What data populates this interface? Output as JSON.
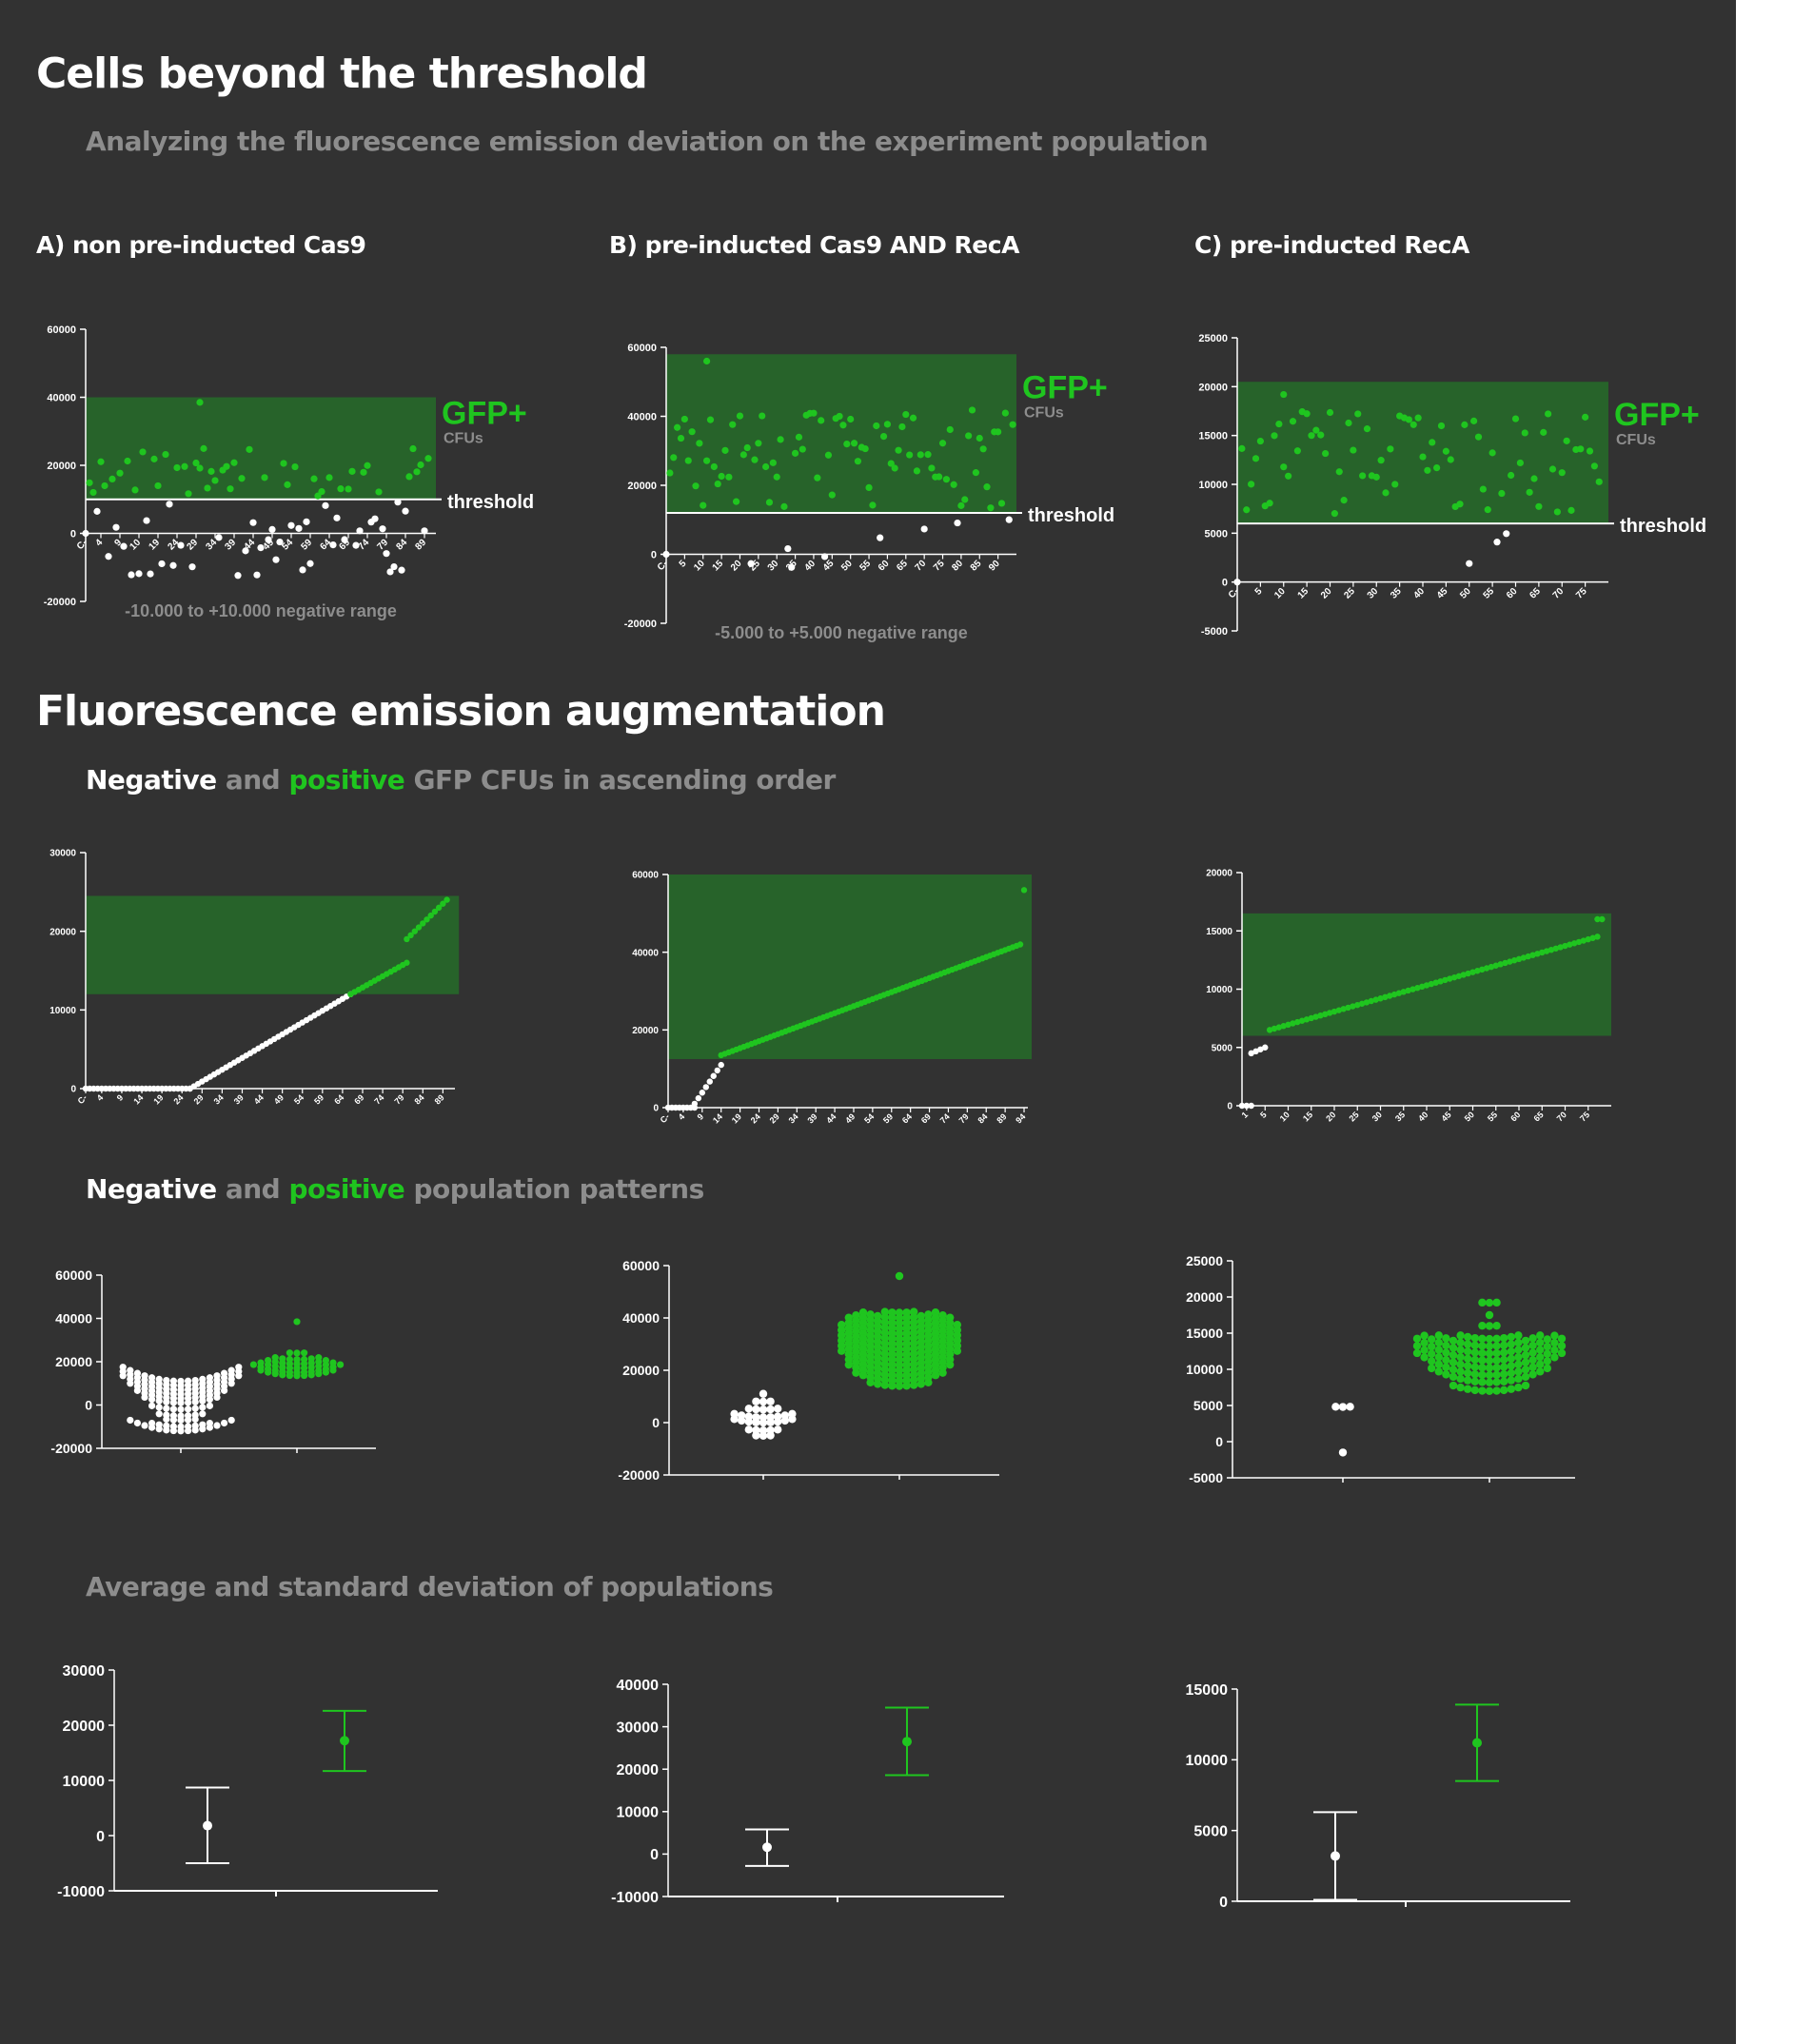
{
  "page": {
    "title": "Cells beyond the threshold",
    "subtitle": "Analyzing the fluorescence emission deviation on the experiment population",
    "section2_title": "Fluorescence emission augmentation",
    "asc": {
      "neg": "Negative",
      "and": "and",
      "pos": "positive",
      "rest": "GFP CFUs in ascending order"
    },
    "pat": {
      "neg": "Negative",
      "and": "and",
      "pos": "positive",
      "rest": "population patterns"
    },
    "avg_title": "Average and standard deviation of populations",
    "colors": {
      "background": "#323232",
      "positive": "#1fc51f",
      "negative": "#ffffff",
      "gfp_band": "#27632a",
      "muted": "#8d8d8d"
    }
  },
  "panels": [
    {
      "title": "A) non pre-inducted Cas9",
      "gfp_label": "GFP+",
      "cfus_label": "CFUs",
      "threshold_label": "threshold",
      "range_note": "-10.000 to +10.000 negative range"
    },
    {
      "title": "B) pre-inducted Cas9 AND RecA",
      "gfp_label": "GFP+",
      "cfus_label": "CFUs",
      "threshold_label": "threshold",
      "range_note": "-5.000 to +5.000 negative range"
    },
    {
      "title": "C) pre-inducted  RecA",
      "gfp_label": "GFP+",
      "cfus_label": "CFUs",
      "threshold_label": "threshold",
      "range_note": ""
    }
  ],
  "chart_data": [
    {
      "id": "scatterA",
      "type": "scatter",
      "ylim": [
        -20000,
        60000
      ],
      "yticks": [
        -20000,
        0,
        20000,
        40000,
        60000
      ],
      "ytick_labels": [
        "-20000",
        "0",
        "20000",
        "40000",
        "60000"
      ],
      "xlim": [
        0,
        92
      ],
      "xticks": [
        0,
        4,
        9,
        14,
        19,
        24,
        29,
        34,
        39,
        44,
        49,
        54,
        59,
        64,
        69,
        74,
        79,
        84,
        89
      ],
      "xtick_labels": [
        "C-",
        "4",
        "9",
        "10",
        "19",
        "24",
        "29",
        "34",
        "39",
        "44",
        "49",
        "54",
        "59",
        "64",
        "69",
        "74",
        "79",
        "84",
        "89"
      ],
      "threshold": 10000,
      "band_top": 40000,
      "gen": {
        "n": 90,
        "seed": 11,
        "pos_frac": 0.5,
        "pos_range": [
          11000,
          25000
        ],
        "neg_range": [
          -13000,
          10000
        ],
        "extra": [
          [
            30,
            38500
          ]
        ]
      }
    },
    {
      "id": "scatterB",
      "type": "scatter",
      "ylim": [
        -20000,
        60000
      ],
      "yticks": [
        -20000,
        0,
        20000,
        40000,
        60000
      ],
      "ytick_labels": [
        "-20000",
        "0",
        "20000",
        "40000",
        "60000"
      ],
      "xlim": [
        0,
        95
      ],
      "xticks": [
        0,
        5,
        10,
        15,
        20,
        25,
        30,
        35,
        40,
        45,
        50,
        55,
        60,
        65,
        70,
        75,
        80,
        85,
        90
      ],
      "xtick_labels": [
        "C-",
        "5",
        "10",
        "15",
        "20",
        "25",
        "30",
        "35",
        "40",
        "45",
        "50",
        "55",
        "60",
        "65",
        "70",
        "75",
        "80",
        "85",
        "90"
      ],
      "threshold": 12000,
      "band_top": 58000,
      "gen": {
        "n": 94,
        "seed": 23,
        "pos_frac": 0.86,
        "pos_range": [
          13000,
          42000
        ],
        "neg_range": [
          -5000,
          11000
        ],
        "extra": [
          [
            11,
            56000
          ]
        ]
      }
    },
    {
      "id": "scatterC",
      "type": "scatter",
      "ylim": [
        -5000,
        25000
      ],
      "yticks": [
        -5000,
        0,
        5000,
        10000,
        15000,
        20000,
        25000
      ],
      "ytick_labels": [
        "-5000",
        "0",
        "5000",
        "10000",
        "15000",
        "20000",
        "25000"
      ],
      "xlim": [
        0,
        80
      ],
      "xticks": [
        0,
        5,
        10,
        15,
        20,
        25,
        30,
        35,
        40,
        45,
        50,
        55,
        60,
        65,
        70,
        75
      ],
      "xtick_labels": [
        "C-",
        "5",
        "10",
        "15",
        "20",
        "25",
        "30",
        "35",
        "40",
        "45",
        "50",
        "55",
        "60",
        "65",
        "70",
        "75"
      ],
      "threshold": 6000,
      "band_top": 20500,
      "gen": {
        "n": 78,
        "seed": 37,
        "pos_frac": 0.93,
        "pos_range": [
          7000,
          17500
        ],
        "neg_range": [
          -1500,
          5000
        ],
        "extra": [
          [
            10,
            19200
          ]
        ]
      }
    },
    {
      "id": "ascA",
      "type": "scatter",
      "ylim": [
        0,
        30000
      ],
      "yticks": [
        0,
        10000,
        20000,
        30000
      ],
      "ytick_labels": [
        "0",
        "10000",
        "20000",
        "30000"
      ],
      "xlim": [
        0,
        92
      ],
      "xticks": [
        0,
        4,
        9,
        14,
        19,
        24,
        29,
        34,
        39,
        44,
        49,
        54,
        59,
        64,
        69,
        74,
        79,
        84,
        89
      ],
      "xtick_labels": [
        "C-",
        "4",
        "9",
        "14",
        "19",
        "24",
        "29",
        "34",
        "39",
        "44",
        "49",
        "54",
        "59",
        "64",
        "69",
        "74",
        "79",
        "84",
        "89"
      ],
      "threshold": 12000,
      "band_top": 24500,
      "band_right": 93,
      "asc": [
        [
          0,
          26,
          0,
          0,
          "n"
        ],
        [
          26,
          66,
          0,
          12000,
          "n"
        ],
        [
          66,
          80,
          12000,
          16000,
          "p"
        ],
        [
          80,
          90,
          19000,
          24000,
          "p"
        ]
      ]
    },
    {
      "id": "ascB",
      "type": "scatter",
      "ylim": [
        0,
        60000
      ],
      "yticks": [
        0,
        20000,
        40000,
        60000
      ],
      "ytick_labels": [
        "0",
        "20000",
        "40000",
        "60000"
      ],
      "xlim": [
        0,
        95
      ],
      "xticks": [
        0,
        4,
        9,
        14,
        19,
        24,
        29,
        34,
        39,
        44,
        49,
        54,
        59,
        64,
        69,
        74,
        79,
        84,
        89,
        94
      ],
      "xtick_labels": [
        "C-",
        "4",
        "9",
        "14",
        "19",
        "24",
        "29",
        "34",
        "39",
        "44",
        "49",
        "54",
        "59",
        "64",
        "69",
        "74",
        "79",
        "84",
        "89",
        "94"
      ],
      "threshold": 12500,
      "band_top": 60000,
      "band_right": 96,
      "asc": [
        [
          0,
          7,
          0,
          0,
          "n"
        ],
        [
          7,
          14,
          1000,
          11000,
          "n"
        ],
        [
          14,
          93,
          13500,
          42000,
          "p"
        ],
        [
          94,
          94,
          56000,
          56000,
          "p"
        ]
      ]
    },
    {
      "id": "ascC",
      "type": "scatter",
      "ylim": [
        0,
        20000
      ],
      "yticks": [
        0,
        5000,
        10000,
        15000,
        20000
      ],
      "ytick_labels": [
        "0",
        "5000",
        "10000",
        "15000",
        "20000"
      ],
      "xlim": [
        0,
        80
      ],
      "xticks": [
        1,
        5,
        10,
        15,
        20,
        25,
        30,
        35,
        40,
        45,
        50,
        55,
        60,
        65,
        70,
        75
      ],
      "xtick_labels": [
        "1",
        "5",
        "10",
        "15",
        "20",
        "25",
        "30",
        "35",
        "40",
        "45",
        "50",
        "55",
        "60",
        "65",
        "70",
        "75"
      ],
      "threshold": 6000,
      "band_top": 16500,
      "band_right": 80,
      "asc": [
        [
          0,
          2,
          0,
          0,
          "n"
        ],
        [
          2,
          5,
          4500,
          5000,
          "n"
        ],
        [
          6,
          77,
          6500,
          14500,
          "p"
        ],
        [
          77,
          78,
          16000,
          16000,
          "p"
        ]
      ]
    },
    {
      "id": "beeA",
      "type": "swarm",
      "ylim": [
        -20000,
        60000
      ],
      "yticks": [
        -20000,
        0,
        20000,
        40000,
        60000
      ],
      "ytick_labels": [
        "-20000",
        "0",
        "20000",
        "40000",
        "60000"
      ],
      "groups": [
        {
          "kind": "neg",
          "rows": [
            [
              11000,
              17
            ],
            [
              9000,
              17
            ],
            [
              7000,
              17
            ],
            [
              5000,
              15
            ],
            [
              3000,
              13
            ],
            [
              1000,
              11
            ],
            [
              -2000,
              9
            ],
            [
              -5000,
              7
            ],
            [
              -7000,
              5
            ],
            [
              -10000,
              9
            ],
            [
              -12000,
              15
            ]
          ]
        },
        {
          "kind": "pos",
          "rows": [
            [
              38500,
              1
            ],
            [
              24000,
              3
            ],
            [
              21000,
              7
            ],
            [
              19000,
              9
            ],
            [
              17000,
              11
            ],
            [
              15000,
              13
            ],
            [
              13500,
              11
            ]
          ]
        }
      ]
    },
    {
      "id": "beeB",
      "type": "swarm",
      "ylim": [
        -20000,
        60000
      ],
      "yticks": [
        -20000,
        0,
        20000,
        40000,
        60000
      ],
      "ytick_labels": [
        "-20000",
        "0",
        "20000",
        "40000",
        "60000"
      ],
      "groups": [
        {
          "kind": "neg",
          "rows": [
            [
              11000,
              1
            ],
            [
              8000,
              3
            ],
            [
              5000,
              5
            ],
            [
              2000,
              9
            ],
            [
              0,
              9
            ],
            [
              -3000,
              5
            ],
            [
              -5000,
              3
            ]
          ]
        },
        {
          "kind": "pos",
          "rows": [
            [
              56000,
              1
            ],
            [
              42000,
              5
            ],
            [
              40000,
              11
            ],
            [
              38000,
              13
            ],
            [
              36000,
              15
            ],
            [
              34000,
              15
            ],
            [
              32000,
              17
            ],
            [
              30000,
              17
            ],
            [
              28000,
              17
            ],
            [
              26000,
              17
            ],
            [
              24000,
              17
            ],
            [
              22000,
              17
            ],
            [
              20000,
              15
            ],
            [
              18000,
              15
            ],
            [
              16000,
              13
            ],
            [
              14000,
              9
            ]
          ]
        }
      ]
    },
    {
      "id": "beeC",
      "type": "swarm",
      "ylim": [
        -5000,
        25000
      ],
      "yticks": [
        -5000,
        0,
        5000,
        10000,
        15000,
        20000,
        25000
      ],
      "ytick_labels": [
        "-5000",
        "0",
        "5000",
        "10000",
        "15000",
        "20000",
        "25000"
      ],
      "groups": [
        {
          "kind": "neg",
          "rows": [
            [
              4800,
              3
            ],
            [
              -1500,
              1
            ]
          ]
        },
        {
          "kind": "pos",
          "rows": [
            [
              19200,
              3
            ],
            [
              17500,
              1
            ],
            [
              16000,
              3
            ],
            [
              14200,
              9
            ],
            [
              13200,
              15
            ],
            [
              12200,
              19
            ],
            [
              11200,
              21
            ],
            [
              10200,
              21
            ],
            [
              9200,
              21
            ],
            [
              8200,
              17
            ],
            [
              7000,
              11
            ]
          ]
        }
      ]
    },
    {
      "id": "errA",
      "type": "errorbar",
      "ylim": [
        -10000,
        30000
      ],
      "yticks": [
        -10000,
        0,
        10000,
        20000,
        30000
      ],
      "ytick_labels": [
        "-10000",
        "0",
        "10000",
        "20000",
        "30000"
      ],
      "series": [
        {
          "kind": "neg",
          "mean": 1800,
          "low": -5000,
          "high": 8700
        },
        {
          "kind": "pos",
          "mean": 17200,
          "low": 11700,
          "high": 22600
        }
      ]
    },
    {
      "id": "errB",
      "type": "errorbar",
      "ylim": [
        -10000,
        40000
      ],
      "yticks": [
        -10000,
        0,
        10000,
        20000,
        30000,
        40000
      ],
      "ytick_labels": [
        "-10000",
        "0",
        "10000",
        "20000",
        "30000",
        "40000"
      ],
      "series": [
        {
          "kind": "neg",
          "mean": 1600,
          "low": -2800,
          "high": 5800
        },
        {
          "kind": "pos",
          "mean": 26500,
          "low": 18600,
          "high": 34500
        }
      ]
    },
    {
      "id": "errC",
      "type": "errorbar",
      "ylim": [
        0,
        15000
      ],
      "yticks": [
        0,
        5000,
        10000,
        15000
      ],
      "ytick_labels": [
        "0",
        "5000",
        "10000",
        "15000"
      ],
      "series": [
        {
          "kind": "neg",
          "mean": 3200,
          "low": 100,
          "high": 6300
        },
        {
          "kind": "pos",
          "mean": 11200,
          "low": 8500,
          "high": 13900
        }
      ]
    }
  ]
}
